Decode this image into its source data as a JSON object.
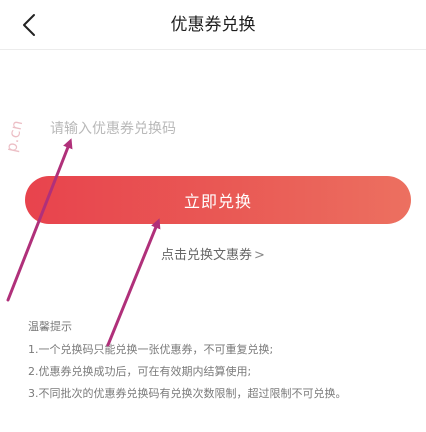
{
  "navbar": {
    "back_icon": "chevron-left-icon",
    "title": "优惠券兑换"
  },
  "code_input": {
    "value": "",
    "placeholder": "请输入优惠券兑换码"
  },
  "redeem_button": {
    "label": "立即兑换"
  },
  "text_coupon_link": {
    "label": "点击兑换文惠券",
    "chevron": ">"
  },
  "tips": {
    "title": "温馨提示",
    "items": [
      "1.一个兑换码只能兑换一张优惠券，不可重复兑换;",
      "2.优惠券兑换成功后，可在有效期内结算使用;",
      "3.不同批次的优惠券兑换码有兑换次数限制，超过限制不可兑换。"
    ]
  },
  "watermark": {
    "text": "p.cn"
  },
  "colors": {
    "button_start": "#e8434d",
    "button_end": "#ec7060",
    "annotation_arrow": "#b0307a"
  }
}
